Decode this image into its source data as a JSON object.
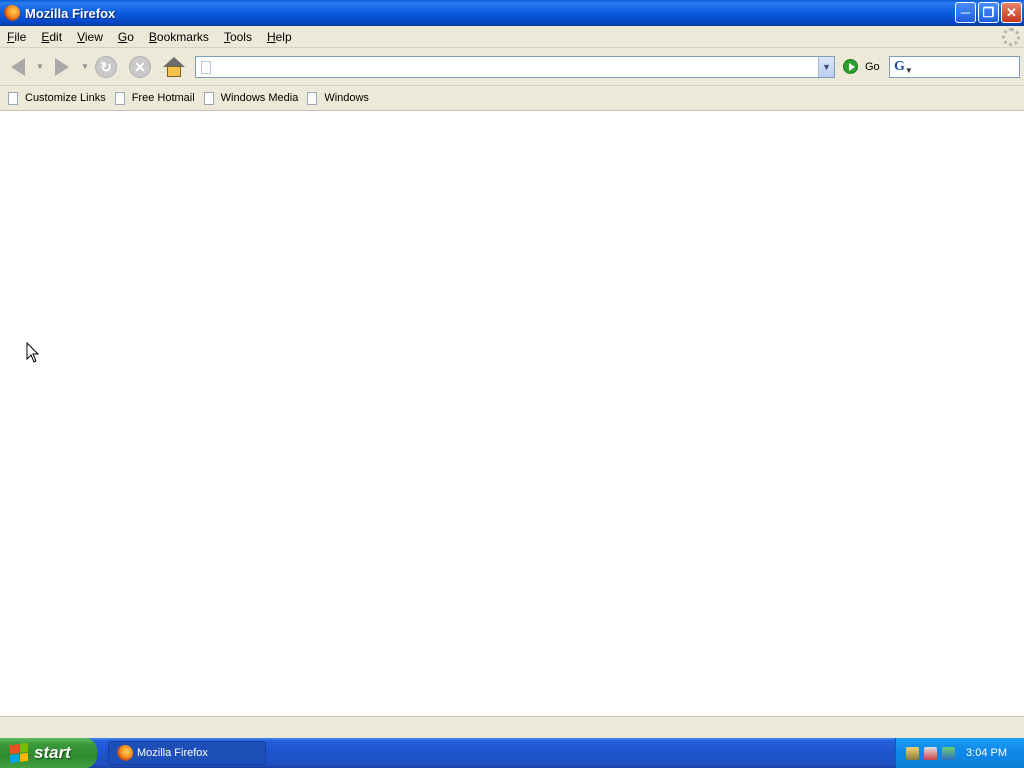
{
  "window": {
    "title": "Mozilla Firefox"
  },
  "menu": {
    "items": [
      {
        "mnemonic": "F",
        "rest": "ile"
      },
      {
        "mnemonic": "E",
        "rest": "dit"
      },
      {
        "mnemonic": "V",
        "rest": "iew"
      },
      {
        "mnemonic": "G",
        "rest": "o"
      },
      {
        "mnemonic": "B",
        "rest": "ookmarks"
      },
      {
        "mnemonic": "T",
        "rest": "ools"
      },
      {
        "mnemonic": "H",
        "rest": "elp"
      }
    ]
  },
  "navigation": {
    "url_value": "",
    "go_label": "Go",
    "search_value": "",
    "search_engine_glyph": "G"
  },
  "bookmarks": {
    "items": [
      "Customize Links",
      "Free Hotmail",
      "Windows Media",
      "Windows"
    ]
  },
  "taskbar": {
    "start_label": "start",
    "task_item_label": "Mozilla Firefox",
    "clock": "3:04 PM"
  }
}
